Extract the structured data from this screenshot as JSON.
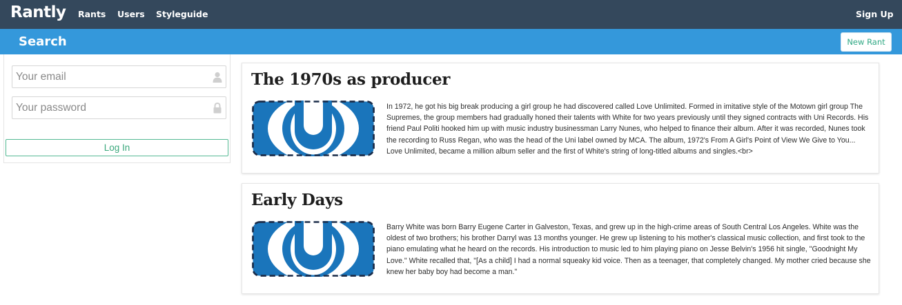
{
  "navbar": {
    "brand": "Rantly",
    "links": [
      "Rants",
      "Users",
      "Styleguide"
    ],
    "signup": "Sign Up"
  },
  "subbar": {
    "title": "Search",
    "new_rant": "New Rant"
  },
  "login": {
    "email_placeholder": "Your email",
    "password_placeholder": "Your password",
    "submit": "Log In",
    "email_icon": "user-icon",
    "password_icon": "lock-icon"
  },
  "rants": [
    {
      "title": "The 1970s as producer",
      "body": "In 1972, he got his big break producing a girl group he had discovered called Love Unlimited. Formed in imitative style of the Motown girl group The Supremes, the group members had gradually honed their talents with White for two years previously until they signed contracts with Uni Records. His friend Paul Politi hooked him up with music industry businessman Larry Nunes, who helped to finance their album. After it was recorded, Nunes took the recording to Russ Regan, who was the head of the Uni label owned by MCA. The album, 1972's From A Girl's Point of View We Give to You... Love Unlimited, became a million album seller and the first of White's string of long-titled albums and singles.<br>"
    },
    {
      "title": "Early Days",
      "body": "Barry White was born Barry Eugene Carter in Galveston, Texas, and grew up in the high-crime areas of South Central Los Angeles. White was the oldest of two brothers; his brother Darryl was 13 months younger. He grew up listening to his mother's classical music collection, and first took to the piano emulating what he heard on the records. His introduction to music led to him playing piano on Jesse Belvin's 1956 hit single, \"Goodnight My Love.\" White recalled that, \"[As a child] I had a normal squeaky kid voice. Then as a teenager, that completely changed. My mother cried because she knew her baby boy had become a man.\""
    }
  ],
  "colors": {
    "navbar": "#34485c",
    "subbar": "#3498db",
    "accent": "#2fa884",
    "logo_blue": "#1a75bb"
  }
}
